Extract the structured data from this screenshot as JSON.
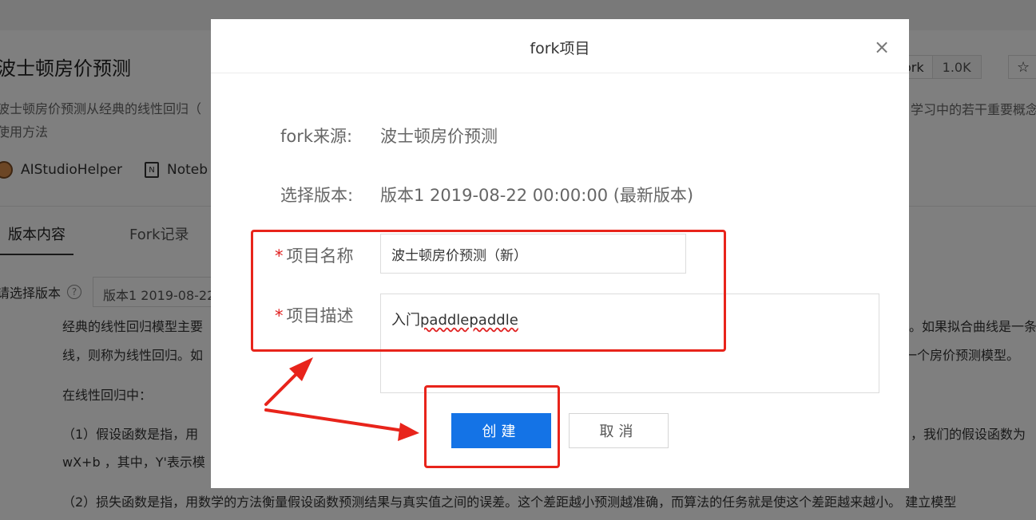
{
  "background": {
    "project_title": "波士顿房价预测",
    "description_line1": "波士顿房价预测从经典的线性回归（",
    "description_line2": "使用方法",
    "description_right": "学习中的若干重要概念",
    "author": "AIStudioHelper",
    "notebook_label": "Noteb",
    "fork_label": "ork",
    "fork_count": "1.0K",
    "star_icon": "☆",
    "tabs": [
      {
        "label": "版本内容"
      },
      {
        "label": "Fork记录"
      }
    ],
    "select_version_label": "请选择版本",
    "help_icon": "?",
    "select_version_value": "版本1 2019-08-22",
    "paragraphs": {
      "p1_left": "经典的线性回归模型主要",
      "p1_right": "。如果拟合曲线是一条",
      "p2_left": "线，则称为线性回归。如",
      "p2_right": "一个房价预测模型。",
      "p3": "在线性回归中：",
      "p4_left": "（1）假设函数是指，用",
      "p4_right": "，我们的假设函数为",
      "p5": "wX+b ，其中，Y'表示模",
      "p6": "（2）损失函数是指，用数学的方法衡量假设函数预测结果与真实值之间的误差。这个差距越小预测越准确，而算法的任务就是使这个差距越来越小。 建立模型"
    }
  },
  "modal": {
    "title": "fork项目",
    "close_icon": "×",
    "source_label": "fork来源:",
    "source_value": "波士顿房价预测",
    "version_label": "选择版本:",
    "version_value": "版本1 2019-08-22 00:00:00 (最新版本)",
    "required_mark": "*",
    "name_label": "项目名称",
    "name_value": "波士顿房价预测（新）",
    "desc_label": "项目描述",
    "desc_prefix": "入门",
    "desc_word": "paddlepaddle",
    "create_button": "创建",
    "cancel_button": "取消"
  },
  "annotation_color": "#e8241b",
  "accent_color": "#1473e6"
}
